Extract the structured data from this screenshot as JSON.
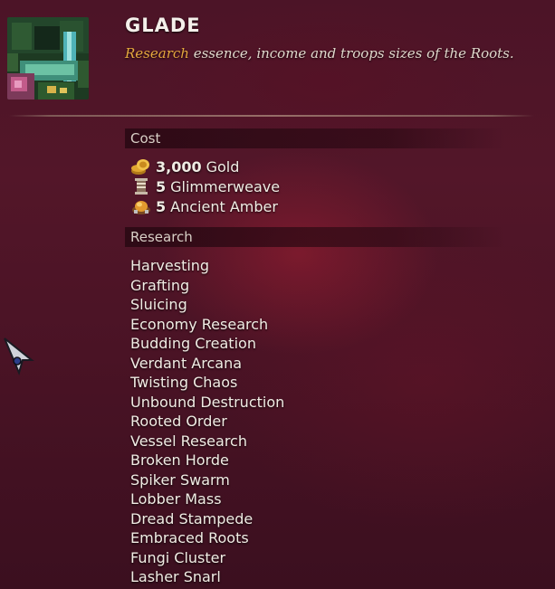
{
  "header": {
    "title": "GLADE",
    "subtitle_accent": "Research",
    "subtitle_rest": " essence, income and troops sizes of the Roots.",
    "portrait_icon": "glade-portrait-icon"
  },
  "colors": {
    "accent": "#e6a83e",
    "background": "#4c1427",
    "text": "#f1ece4"
  },
  "cost": {
    "heading": "Cost",
    "items": [
      {
        "amount": "3,000",
        "resource": "Gold",
        "icon": "gold-coins-icon"
      },
      {
        "amount": "5",
        "resource": "Glimmerweave",
        "icon": "glimmerweave-spool-icon"
      },
      {
        "amount": "5",
        "resource": "Ancient Amber",
        "icon": "ancient-amber-icon"
      }
    ]
  },
  "research": {
    "heading": "Research",
    "items": [
      "Harvesting",
      "Grafting",
      "Sluicing",
      "Economy Research",
      "Budding Creation",
      "Verdant Arcana",
      "Twisting Chaos",
      "Unbound Destruction",
      "Rooted Order",
      "Vessel Research",
      "Broken Horde",
      "Spiker Swarm",
      "Lobber Mass",
      "Dread Stampede",
      "Embraced Roots",
      "Fungi Cluster",
      "Lasher Snarl"
    ]
  }
}
